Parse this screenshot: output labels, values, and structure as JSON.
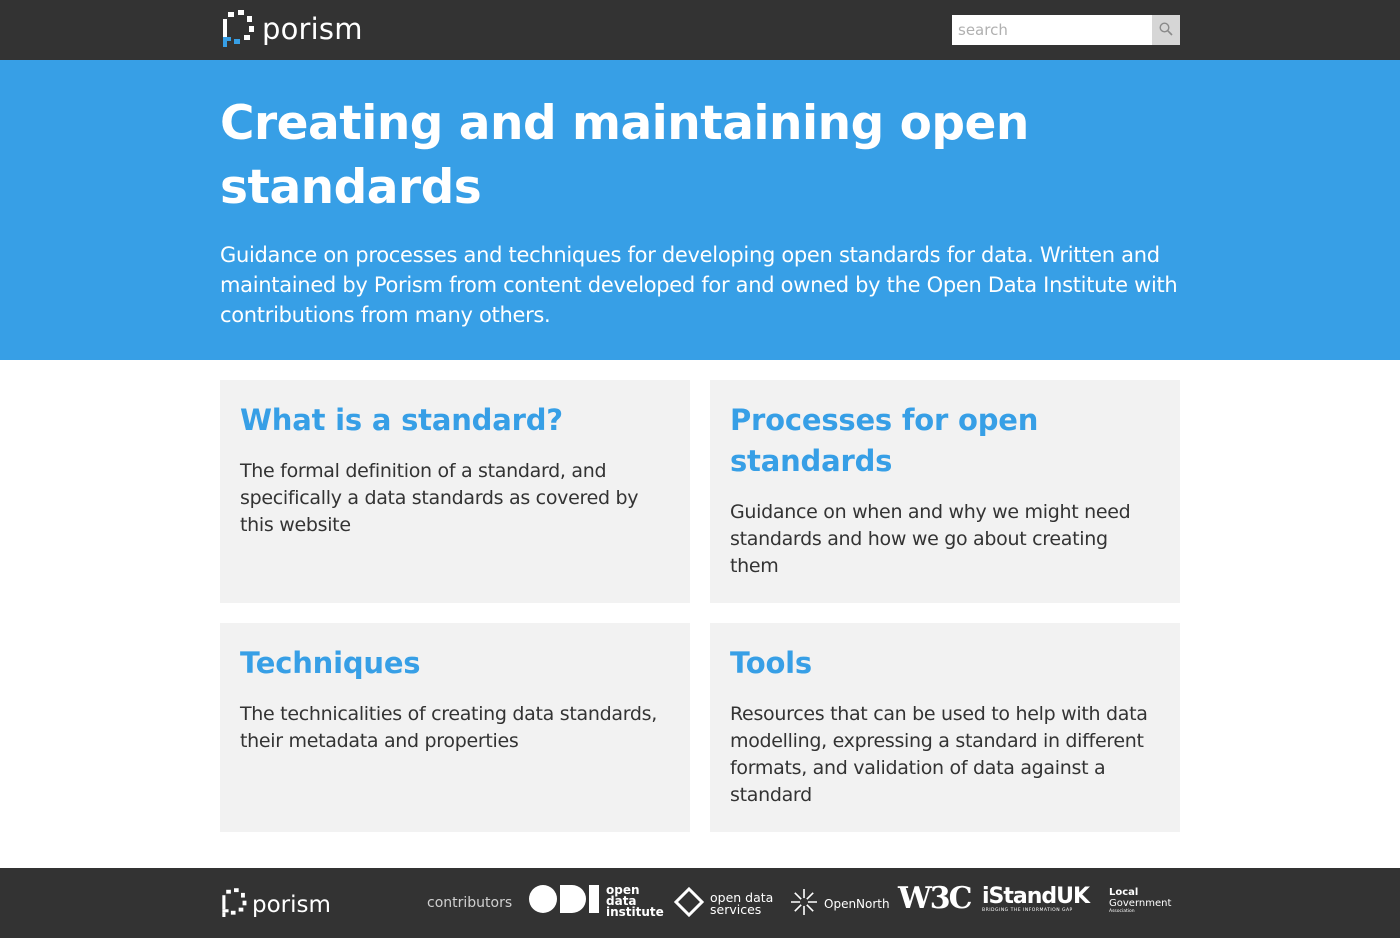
{
  "header": {
    "logo_text": "porism",
    "search_placeholder": "search"
  },
  "hero": {
    "title": "Creating and maintaining open standards",
    "subtitle": "Guidance on processes and techniques for developing open standards for data. Written and maintained by Porism from content developed for and owned by the Open Data Institute with contributions from many others."
  },
  "cards": [
    {
      "title": "What is a standard?",
      "description": "The formal definition of a standard, and specifically a data standards as covered by this website"
    },
    {
      "title": "Processes for open standards",
      "description": "Guidance on when and why we might need standards and how we go about creating them"
    },
    {
      "title": "Techniques",
      "description": "The technicalities of creating data standards, their metadata and properties"
    },
    {
      "title": "Tools",
      "description": "Resources that can be used to help with data modelling, expressing a standard in different formats, and validation of data against a standard"
    }
  ],
  "footer": {
    "logo_text": "porism",
    "contributors_label": "contributors",
    "partners": {
      "odi": [
        "open",
        "data",
        "institute"
      ],
      "ods": [
        "open data",
        "services"
      ],
      "opennorth": "OpenNorth",
      "w3c": "W3C",
      "istand": {
        "main": "iStandUK",
        "sub": "BRIDGING THE INFORMATION GAP"
      },
      "lga": [
        "Local",
        "Government",
        "Association"
      ]
    }
  },
  "colors": {
    "topbar": "#333333",
    "hero": "#379fe6",
    "accent": "#379fe6",
    "card_bg": "#f2f2f2"
  },
  "icons": {
    "logo": "porism-logo-icon",
    "search": "search-icon"
  }
}
